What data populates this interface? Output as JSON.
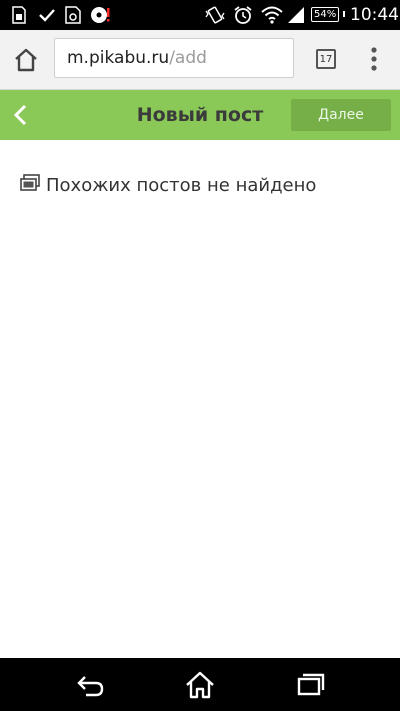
{
  "status_bar": {
    "battery": "54%",
    "time": "10:44"
  },
  "browser": {
    "url_domain": "m.pikabu.ru",
    "url_path": "/add",
    "tab_count": "17"
  },
  "header": {
    "title": "Новый пост",
    "next_label": "Далее",
    "accent_color": "#8ac858",
    "button_color": "#76af48"
  },
  "content": {
    "no_similar_text": "Похожих постов не найдено"
  },
  "icons": {
    "browser_home": "home-icon",
    "browser_menu": "more-vert-icon",
    "header_back": "chevron-left-icon",
    "posts": "posts-stack-icon",
    "nav_back": "back-arrow-icon",
    "nav_home": "home-outline-icon",
    "nav_recents": "recents-icon"
  }
}
